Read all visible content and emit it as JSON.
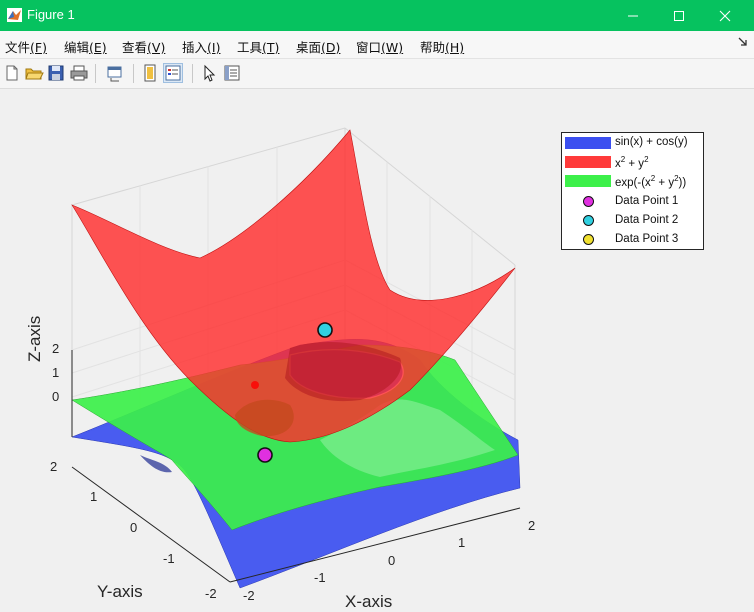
{
  "window": {
    "title": "Figure 1"
  },
  "menu": [
    {
      "label": "文件",
      "key": "(F)"
    },
    {
      "label": "编辑",
      "key": "(E)"
    },
    {
      "label": "查看",
      "key": "(V)"
    },
    {
      "label": "插入",
      "key": "(I)"
    },
    {
      "label": "工具",
      "key": "(T)"
    },
    {
      "label": "桌面",
      "key": "(D)"
    },
    {
      "label": "窗口",
      "key": "(W)"
    },
    {
      "label": "帮助",
      "key": "(H)"
    }
  ],
  "toolbar": {
    "icons": [
      "new-figure-icon",
      "open-file-icon",
      "save-icon",
      "print-icon",
      "link-plot-icon",
      "hide-plot-tools-icon",
      "show-plot-tools-icon",
      "edit-plot-icon",
      "property-inspector-icon"
    ]
  },
  "chart_data": {
    "type": "surface3d",
    "xlabel": "X-axis",
    "ylabel": "Y-axis",
    "zlabel": "Z-axis",
    "xlim": [
      -2,
      2
    ],
    "ylim": [
      -2,
      2
    ],
    "x_ticks": [
      "-2",
      "-1",
      "0",
      "1",
      "2"
    ],
    "y_ticks": [
      "-2",
      "-1",
      "0",
      "1",
      "2"
    ],
    "z_ticks": [
      "0",
      "1",
      "2"
    ],
    "grid": true,
    "legend_position": "top-right",
    "series": [
      {
        "name": "sin(x) + cos(y)",
        "kind": "surface",
        "color": "#3b4ff0"
      },
      {
        "name": "x^2 + y^2",
        "kind": "surface",
        "color": "#ff3030"
      },
      {
        "name": "exp(-(x^2 + y^2))",
        "kind": "surface",
        "color": "#3cf04a"
      },
      {
        "name": "Data Point 1",
        "kind": "point",
        "color": "#e030e0"
      },
      {
        "name": "Data Point 2",
        "kind": "point",
        "color": "#30d0e0"
      },
      {
        "name": "Data Point 3",
        "kind": "point",
        "color": "#f0e030"
      }
    ]
  }
}
